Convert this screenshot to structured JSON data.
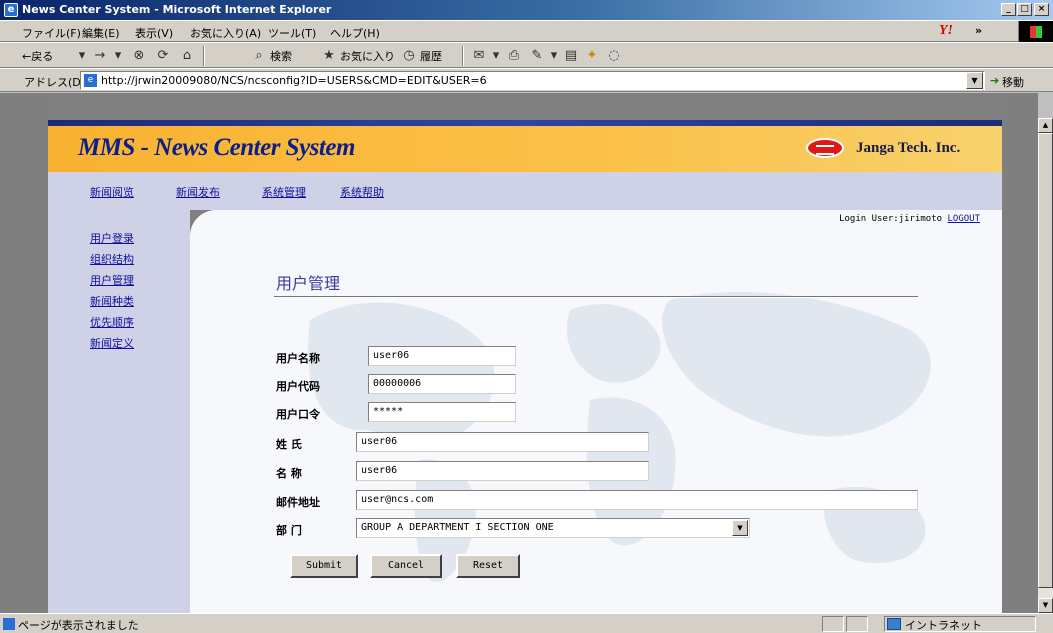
{
  "window": {
    "title": "News Center System - Microsoft Internet Explorer",
    "minimize": "_",
    "maximize": "□",
    "close": "×"
  },
  "menu": {
    "items": [
      "ファイル(F)",
      "編集(E)",
      "表示(V)",
      "お気に入り(A)",
      "ツール(T)",
      "ヘルプ(H)"
    ],
    "chevron": "»"
  },
  "toolbar": {
    "back": "←戻る",
    "search": "検索",
    "favorites": "お気に入り",
    "history": "履歴"
  },
  "address": {
    "label": "アドレス(D)",
    "url": "http://jrwin20009080/NCS/ncsconfig?ID=USERS&CMD=EDIT&USER=6",
    "go": "移動"
  },
  "site": {
    "title": "MMS - News Center System",
    "company": "Janga Tech. Inc."
  },
  "nav": {
    "items": [
      "新闻阅览",
      "新闻发布",
      "系统管理",
      "系统帮助"
    ]
  },
  "sidebar": {
    "items": [
      "用户登录",
      "组织结构",
      "用户管理",
      "新闻种类",
      "优先顺序",
      "新闻定义"
    ]
  },
  "login": {
    "prefix": "Login User:",
    "user": "jirimoto",
    "logout": "LOGOUT"
  },
  "page": {
    "title": "用户管理"
  },
  "form": {
    "fields": [
      {
        "label": "用户名称",
        "value": "user06"
      },
      {
        "label": "用户代码",
        "value": "00000006"
      },
      {
        "label": "用户口令",
        "value": "*****"
      },
      {
        "label": "姓 氏",
        "value": "user06"
      },
      {
        "label": "名 称",
        "value": "user06"
      },
      {
        "label": "邮件地址",
        "value": "user@ncs.com"
      }
    ],
    "department": {
      "label": "部 门",
      "selected": "GROUP A DEPARTMENT I SECTION ONE"
    },
    "buttons": {
      "submit": "Submit",
      "cancel": "Cancel",
      "reset": "Reset"
    }
  },
  "status": {
    "text": "ページが表示されました",
    "zone": "イントラネット"
  }
}
